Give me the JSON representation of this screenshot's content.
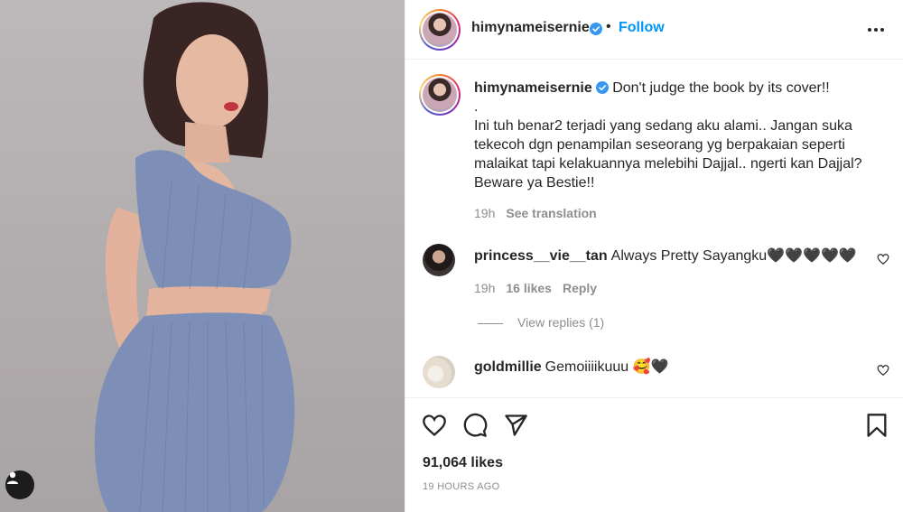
{
  "post": {
    "username": "himynameisernie",
    "follow_label": "Follow",
    "separator": "•",
    "likes": "91,064 likes",
    "timestamp": "19 HOURS AGO"
  },
  "caption": {
    "username": "himynameisernie",
    "first_line": "Don't judge the book by its cover!!",
    "body": ".\nIni tuh benar2 terjadi yang sedang aku alami.. Jangan suka tekecoh dgn penampilan seseorang yg berpakaian seperti malaikat tapi kelakuannya melebihi Dajjal.. ngerti kan Dajjal? Beware ya Bestie!!",
    "time": "19h",
    "see_translation": "See translation"
  },
  "comments": [
    {
      "username": "princess__vie__tan",
      "text": "Always Pretty Sayangku🖤🖤🖤🖤🖤",
      "time": "19h",
      "likes": "16 likes",
      "reply": "Reply",
      "view_replies": "View replies (1)"
    },
    {
      "username": "goldmillie",
      "text": "Gemoiiiikuuu 🥰🖤"
    }
  ],
  "icons": {
    "verified": "verified-badge-icon",
    "more": "more-options-icon",
    "like": "heart-icon",
    "comment": "comment-icon",
    "share": "share-icon",
    "save": "bookmark-icon",
    "tag": "user-tag-icon"
  },
  "colors": {
    "link": "#0095f6",
    "verified": "#3897f0",
    "text": "#262626",
    "muted": "#8e8e8e",
    "dress": "#7d8fb6"
  }
}
